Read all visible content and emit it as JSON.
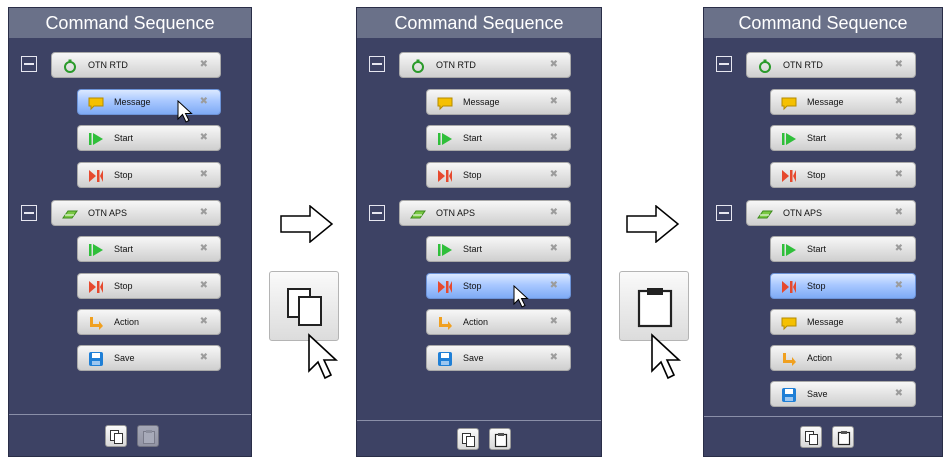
{
  "panel1": {
    "title": "Command Sequence",
    "nodes": [
      {
        "label": "OTN RTD",
        "icon": "timer-icon"
      },
      {
        "label": "Message",
        "icon": "message-icon"
      },
      {
        "label": "Start",
        "icon": "start-icon"
      },
      {
        "label": "Stop",
        "icon": "stop-icon"
      },
      {
        "label": "OTN APS",
        "icon": "aps-icon"
      },
      {
        "label": "Start",
        "icon": "start-icon"
      },
      {
        "label": "Stop",
        "icon": "stop-icon"
      },
      {
        "label": "Action",
        "icon": "action-icon"
      },
      {
        "label": "Save",
        "icon": "save-icon"
      }
    ],
    "selected": "Message",
    "paste_enabled": false
  },
  "panel2": {
    "title": "Command Sequence",
    "nodes": [
      {
        "label": "OTN RTD",
        "icon": "timer-icon"
      },
      {
        "label": "Message",
        "icon": "message-icon"
      },
      {
        "label": "Start",
        "icon": "start-icon"
      },
      {
        "label": "Stop",
        "icon": "stop-icon"
      },
      {
        "label": "OTN APS",
        "icon": "aps-icon"
      },
      {
        "label": "Start",
        "icon": "start-icon"
      },
      {
        "label": "Stop",
        "icon": "stop-icon"
      },
      {
        "label": "Action",
        "icon": "action-icon"
      },
      {
        "label": "Save",
        "icon": "save-icon"
      }
    ],
    "selected": "Stop",
    "paste_enabled": true
  },
  "panel3": {
    "title": "Command Sequence",
    "nodes": [
      {
        "label": "OTN RTD",
        "icon": "timer-icon"
      },
      {
        "label": "Message",
        "icon": "message-icon"
      },
      {
        "label": "Start",
        "icon": "start-icon"
      },
      {
        "label": "Stop",
        "icon": "stop-icon"
      },
      {
        "label": "OTN APS",
        "icon": "aps-icon"
      },
      {
        "label": "Start",
        "icon": "start-icon"
      },
      {
        "label": "Stop",
        "icon": "stop-icon"
      },
      {
        "label": "Message",
        "icon": "message-icon"
      },
      {
        "label": "Action",
        "icon": "action-icon"
      },
      {
        "label": "Save",
        "icon": "save-icon"
      }
    ],
    "selected": "Stop",
    "paste_enabled": true
  },
  "step1": {
    "button": "copy-icon"
  },
  "step2": {
    "button": "paste-icon"
  },
  "delete_glyph": "✖",
  "colors": {
    "panel_bg": "#3d4264",
    "title_bg": "#6a7189",
    "selected_row": "#a9c8ff",
    "start_green": "#2fbf3a",
    "stop_red": "#e6492e",
    "message_yellow": "#f5c000",
    "action_orange": "#f0a020",
    "save_blue": "#1f7fd6"
  }
}
